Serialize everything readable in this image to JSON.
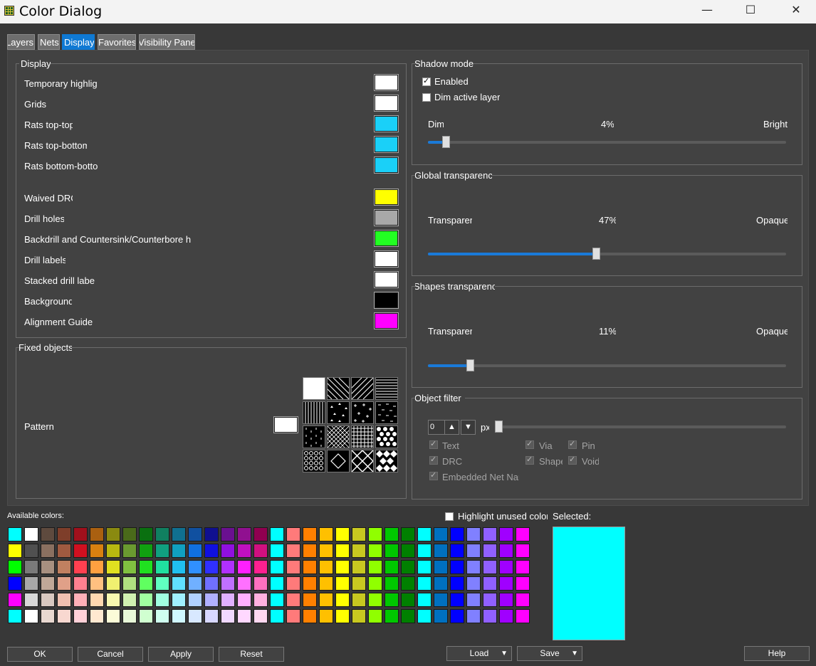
{
  "window": {
    "title": "Color Dialog",
    "minimize": "—",
    "maximize": "☐",
    "close": "✕"
  },
  "tabs": [
    {
      "label": "Layers"
    },
    {
      "label": "Nets"
    },
    {
      "label": "Display",
      "active": true
    },
    {
      "label": "Favorites"
    },
    {
      "label": "Visibility Pane"
    }
  ],
  "display_group": {
    "title": "Display",
    "items": [
      {
        "label": "Temporary highlig",
        "color": "#ffffff"
      },
      {
        "label": "Grids",
        "color": "#ffffff"
      },
      {
        "label": "Rats top-top",
        "color": "#1ad0f8"
      },
      {
        "label": "Rats top-bottom",
        "color": "#1ad0f8"
      },
      {
        "label": "Rats bottom-botto",
        "color": "#1ad0f8"
      },
      {
        "label": "Waived DRC",
        "color": "#ffff00"
      },
      {
        "label": "Drill holes",
        "color": "#a8a8a8"
      },
      {
        "label": "Backdrill and Countersink/Counterbore h",
        "color": "#22ff22"
      },
      {
        "label": "Drill labels",
        "color": "#ffffff"
      },
      {
        "label": "Stacked drill labe",
        "color": "#ffffff"
      },
      {
        "label": "Background",
        "color": "#000000"
      },
      {
        "label": "Alignment Guide",
        "color": "#ff00ff"
      }
    ]
  },
  "fixed_objects": {
    "title": "Fixed objects",
    "pattern_label": "Pattern",
    "pattern_color": "#ffffff",
    "patterns": [
      "solid",
      "diag-back",
      "diag-fwd",
      "horizontal",
      "vertical",
      "triangles",
      "plus",
      "dashes",
      "dots-vertical",
      "crosshatch-diag",
      "grid",
      "circles",
      "checker-dots",
      "diamond",
      "diamond-lattice",
      "diamond-check"
    ]
  },
  "shadow_mode": {
    "title": "Shadow mode",
    "enabled_label": "Enabled",
    "enabled": true,
    "dim_label": "Dim active layer",
    "dim": false,
    "min_label": "Dim",
    "max_label": "Bright",
    "value_text": "4%",
    "value": 0.04
  },
  "global_transparency": {
    "title": "Global transparency",
    "min_label": "Transparent",
    "max_label": "Opaque",
    "value_text": "47%",
    "value": 0.47
  },
  "shapes_transparency": {
    "title": "Shapes transparency",
    "min_label": "Transparent",
    "max_label": "Opaque",
    "value_text": "11%",
    "value": 0.11
  },
  "object_filter": {
    "title": "Object filter",
    "spin_value": "0",
    "unit": "px",
    "checks": [
      {
        "label": "Text",
        "checked": true
      },
      {
        "label": "Via",
        "checked": true
      },
      {
        "label": "Pin",
        "checked": true
      },
      {
        "label": "DRC",
        "checked": true
      },
      {
        "label": "Shape",
        "checked": true
      },
      {
        "label": "Void",
        "checked": true
      },
      {
        "label": "Embedded Net Name",
        "checked": true
      }
    ]
  },
  "palette": {
    "available_label": "Available colors:",
    "highlight_label": "Highlight unused colors",
    "highlight": false,
    "selected_label": "Selected:",
    "selected_color": "#00ffff",
    "rows": [
      [
        "#00ffff",
        "#ffffff",
        "#5e4a3e",
        "#7e3e2a",
        "#a0101c",
        "#aa6010",
        "#8a8a10",
        "#4a6a1a",
        "#0a7010",
        "#108060",
        "#107090",
        "#1050a0",
        "#101090",
        "#6a1090",
        "#901090",
        "#900050",
        "#00ffff",
        "#ff7a7a",
        "#ff8000",
        "#ffc000",
        "#ffff00",
        "#c8c820",
        "#90ff00",
        "#00c800",
        "#008000",
        "#00ffff",
        "#0070c0",
        "#0000ff",
        "#8080ff",
        "#9060ff",
        "#a000ff",
        "#ff00ff"
      ],
      [
        "#ffff00",
        "#505050",
        "#8a7060",
        "#a05a40",
        "#d01020",
        "#d88010",
        "#b8b810",
        "#6a9a30",
        "#10a010",
        "#10a080",
        "#10a0c0",
        "#1070e0",
        "#1010e0",
        "#9010e0",
        "#c010c0",
        "#d01080",
        "#00ffff",
        "#ff7a7a",
        "#ff8000",
        "#ffc000",
        "#ffff00",
        "#c8c820",
        "#90ff00",
        "#00c800",
        "#008000",
        "#00ffff",
        "#0070c0",
        "#0000ff",
        "#8080ff",
        "#9060ff",
        "#a000ff",
        "#ff00ff"
      ],
      [
        "#00ff00",
        "#7a7a7a",
        "#a89080",
        "#c08060",
        "#ff4050",
        "#ffa040",
        "#e0e020",
        "#80c040",
        "#20e020",
        "#20e0a0",
        "#20c0f0",
        "#3090ff",
        "#3030ff",
        "#b030ff",
        "#ff20ff",
        "#ff2090",
        "#00ffff",
        "#ff7a7a",
        "#ff8000",
        "#ffc000",
        "#ffff00",
        "#c8c820",
        "#90ff00",
        "#00c800",
        "#008000",
        "#00ffff",
        "#0070c0",
        "#0000ff",
        "#8080ff",
        "#9060ff",
        "#a000ff",
        "#ff00ff"
      ],
      [
        "#0000ff",
        "#a8a8a8",
        "#c0a898",
        "#e0a088",
        "#ff8090",
        "#ffc080",
        "#f0f070",
        "#b0e080",
        "#60ff60",
        "#60ffc0",
        "#60e0ff",
        "#70b0ff",
        "#7070ff",
        "#c070ff",
        "#ff70ff",
        "#ff70c0",
        "#00ffff",
        "#ff7a7a",
        "#ff8000",
        "#ffc000",
        "#ffff00",
        "#c8c820",
        "#90ff00",
        "#00c800",
        "#008000",
        "#00ffff",
        "#0070c0",
        "#0000ff",
        "#8080ff",
        "#9060ff",
        "#a000ff",
        "#ff00ff"
      ],
      [
        "#ff00ff",
        "#d8d8d8",
        "#d8c8c0",
        "#f0c0b0",
        "#ffb0b8",
        "#ffd8b0",
        "#f8f8b0",
        "#d0f0b0",
        "#a0ffa0",
        "#a0ffe0",
        "#a0f0ff",
        "#b0d0ff",
        "#b0b0ff",
        "#e0b0ff",
        "#ffb0ff",
        "#ffb0e0",
        "#00ffff",
        "#ff7a7a",
        "#ff8000",
        "#ffc000",
        "#ffff00",
        "#c8c820",
        "#90ff00",
        "#00c800",
        "#008000",
        "#00ffff",
        "#0070c0",
        "#0000ff",
        "#8080ff",
        "#9060ff",
        "#a000ff",
        "#ff00ff"
      ],
      [
        "#00ffff",
        "#ffffff",
        "#e8d8d0",
        "#f8d8d0",
        "#ffd0d8",
        "#ffe8d0",
        "#fcfcd8",
        "#e8f8d8",
        "#d0ffd0",
        "#d0fff0",
        "#d0f8ff",
        "#d8e8ff",
        "#d8d8ff",
        "#f0d8ff",
        "#ffd8ff",
        "#ffd8f0",
        "#00ffff",
        "#ff7a7a",
        "#ff8000",
        "#ffc000",
        "#ffff00",
        "#c8c820",
        "#90ff00",
        "#00c800",
        "#008000",
        "#00ffff",
        "#0070c0",
        "#0000ff",
        "#8080ff",
        "#9060ff",
        "#a000ff",
        "#ff00ff"
      ]
    ]
  },
  "buttons": {
    "ok": "OK",
    "cancel": "Cancel",
    "apply": "Apply",
    "reset": "Reset",
    "load": "Load",
    "save": "Save",
    "help": "Help",
    "dropdown_arrow": "▼"
  }
}
